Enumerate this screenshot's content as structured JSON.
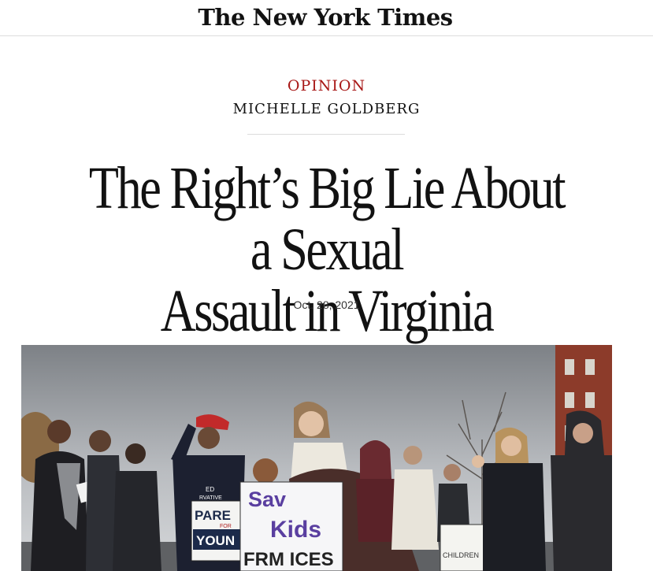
{
  "masthead": {
    "logo_text": "The New York Times"
  },
  "article": {
    "section": "OPINION",
    "author": "MICHELLE GOLDBERG",
    "headline_line1": "The Right’s Big Lie About a Sexual",
    "headline_line2": "Assault in Virginia",
    "date": "Oct. 28, 2021"
  },
  "photo": {
    "sign_left_line1": "PARE",
    "sign_left_line2": "FOR",
    "sign_left_line3": "YOUN",
    "sign_center_line1": "Sav",
    "sign_center_line2": "Kids",
    "sign_center_line3": "FRM  ICES",
    "shirt_text_line1": "ED",
    "shirt_text_line2": "RVATIVE",
    "sign_right_text": "CHILDREN"
  },
  "colors": {
    "kicker": "#a81817",
    "text": "#121212",
    "rule": "#dcdcdc",
    "sign_purple": "#5a3fa0"
  }
}
